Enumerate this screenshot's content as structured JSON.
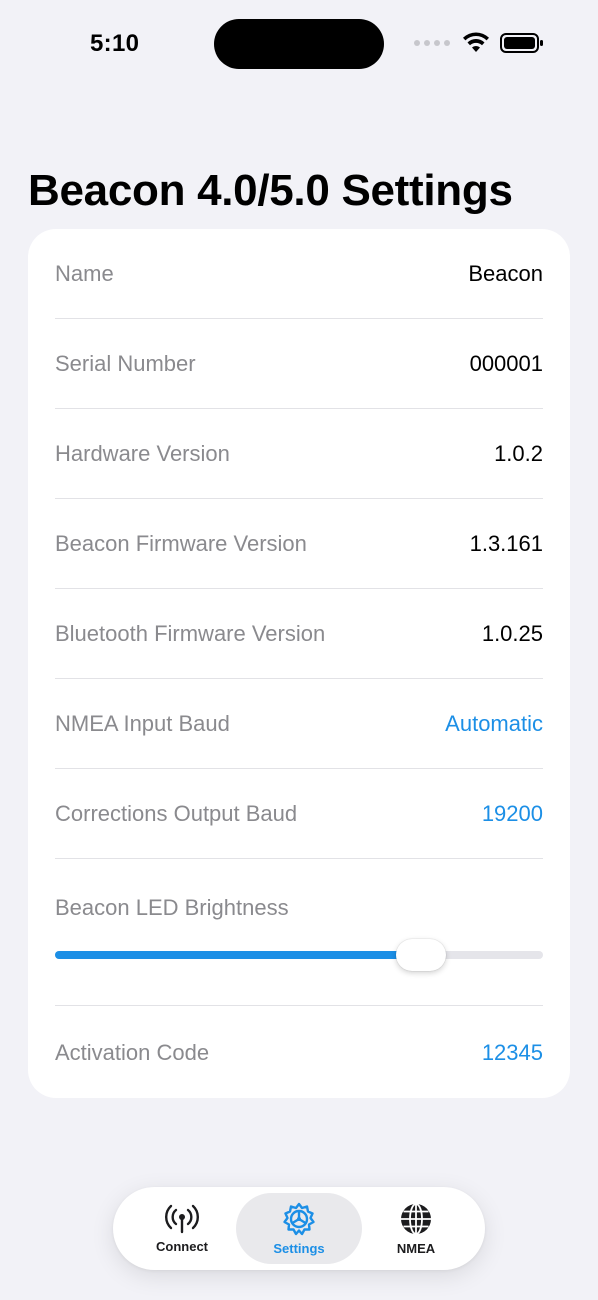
{
  "status_bar": {
    "time": "5:10"
  },
  "page": {
    "title": "Beacon 4.0/5.0 Settings"
  },
  "settings": {
    "rows": [
      {
        "label": "Name",
        "value": "Beacon"
      },
      {
        "label": "Serial Number",
        "value": "000001"
      },
      {
        "label": "Hardware Version",
        "value": "1.0.2"
      },
      {
        "label": "Beacon Firmware Version",
        "value": "1.3.161"
      },
      {
        "label": "Bluetooth Firmware Version",
        "value": "1.0.25"
      },
      {
        "label": "NMEA Input Baud",
        "value": "Automatic"
      },
      {
        "label": "Corrections Output Baud",
        "value": "19200"
      }
    ],
    "brightness": {
      "label": "Beacon LED Brightness",
      "level": 0.75
    },
    "activation": {
      "label": "Activation Code",
      "value": "12345"
    }
  },
  "tabbar": {
    "tabs": [
      {
        "label": "Connect",
        "icon": "antenna-icon",
        "selected": false
      },
      {
        "label": "Settings",
        "icon": "gear-icon",
        "selected": true
      },
      {
        "label": "NMEA",
        "icon": "globe-icon",
        "selected": false
      }
    ]
  },
  "colors": {
    "accent": "#1c8fe6",
    "background": "#f2f2f7",
    "card": "#ffffff"
  }
}
